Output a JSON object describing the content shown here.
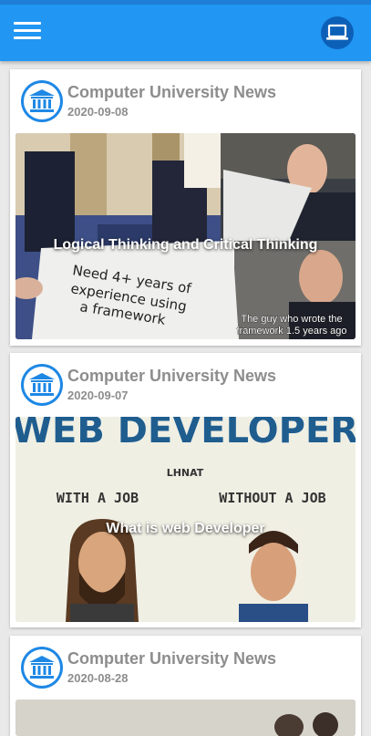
{
  "app": {
    "menu_icon": "hamburger-menu-icon",
    "action_icon": "laptop-icon",
    "accent": "#2196f3"
  },
  "posts": [
    {
      "source": "Computer University News",
      "date": "2020-09-08",
      "title": "Logical Thinking and Critical Thinking",
      "meme_paper_text": "Need 4+ years of experience using a framework",
      "meme_paper_line1": "Need 4+ years of",
      "meme_paper_line2": "experience using",
      "meme_paper_line3": "a framework",
      "meme_caption_line1": "The guy who wrote the",
      "meme_caption_line2": "framework 1.5 years ago"
    },
    {
      "source": "Computer University News",
      "date": "2020-09-07",
      "title": "What is web Developer",
      "image_heading": "WEB DEVELOPER",
      "image_brand": "LHNAT",
      "image_left_label": "WITH A JOB",
      "image_right_label": "WITHOUT A JOB"
    },
    {
      "source": "Computer University News",
      "date": "2020-08-28"
    }
  ]
}
